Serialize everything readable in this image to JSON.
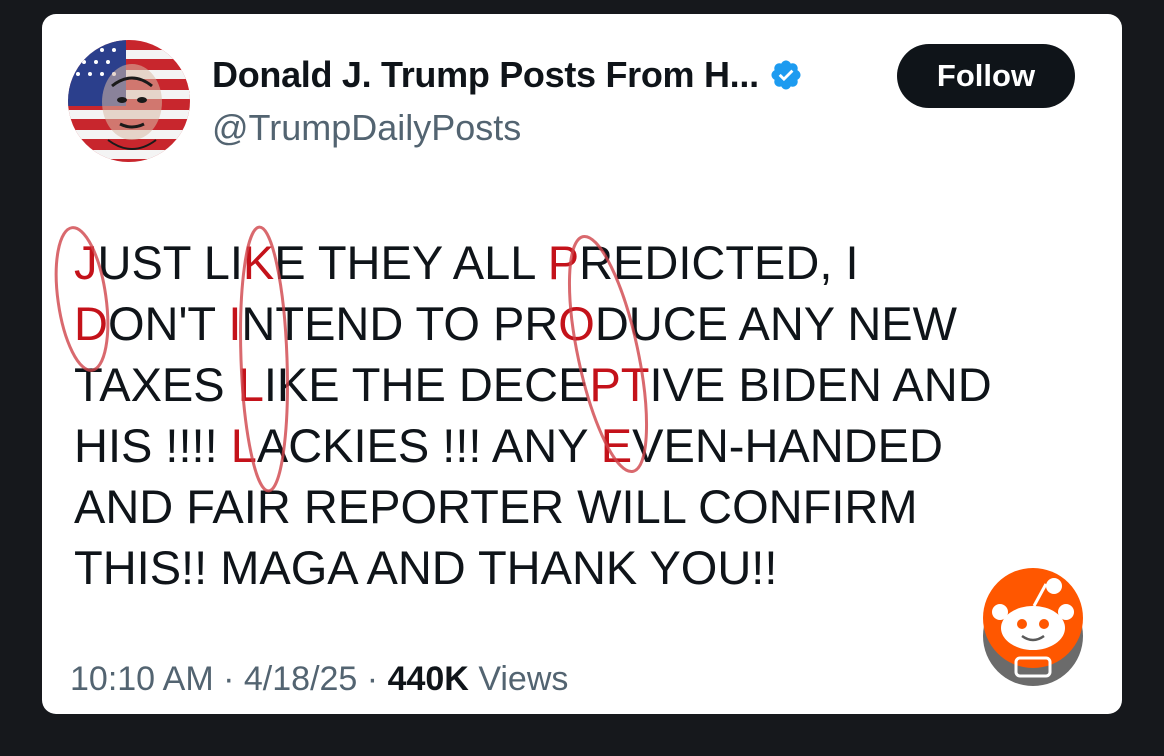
{
  "tweet": {
    "author": {
      "display_name": "Donald J. Trump Posts From H...",
      "handle": "@TrumpDailyPosts",
      "verified_icon": "verified-badge-icon",
      "verified_color": "#1d9bf0"
    },
    "follow_button_label": "Follow",
    "text_lines": [
      {
        "segments": [
          {
            "t": "J",
            "hl": true
          },
          {
            "t": "UST LI"
          },
          {
            "t": "K",
            "hl": true
          },
          {
            "t": "E THEY ALL "
          },
          {
            "t": "P",
            "hl": true
          },
          {
            "t": "REDICTED, I"
          }
        ]
      },
      {
        "segments": [
          {
            "t": "D",
            "hl": true
          },
          {
            "t": "ON'T "
          },
          {
            "t": "I",
            "hl": true
          },
          {
            "t": "NTEND TO PR"
          },
          {
            "t": "O",
            "hl": true
          },
          {
            "t": "DUCE ANY NEW"
          }
        ]
      },
      {
        "segments": [
          {
            "t": "TAXES "
          },
          {
            "t": "L",
            "hl": true
          },
          {
            "t": "IKE THE DECE"
          },
          {
            "t": "PT",
            "hl": true
          },
          {
            "t": "IVE BIDEN AND"
          }
        ]
      },
      {
        "segments": [
          {
            "t": "HIS !!!! "
          },
          {
            "t": "L",
            "hl": true
          },
          {
            "t": "ACKIES !!! ANY "
          },
          {
            "t": "E",
            "hl": true
          },
          {
            "t": "VEN-HANDED"
          }
        ]
      },
      {
        "segments": [
          {
            "t": "AND FAIR REPORTER WILL CONFIRM"
          }
        ]
      },
      {
        "segments": [
          {
            "t": "THIS!! MAGA AND THANK YOU!!"
          }
        ]
      }
    ],
    "highlight_color": "#c4121a",
    "time": "10:10 AM",
    "date": "4/18/25",
    "separator": "·",
    "views_count": "440K",
    "views_label": "Views"
  },
  "overlay": {
    "reddit_badge_icon": "reddit-snoo-icon",
    "reddit_color": "#ff5700"
  }
}
